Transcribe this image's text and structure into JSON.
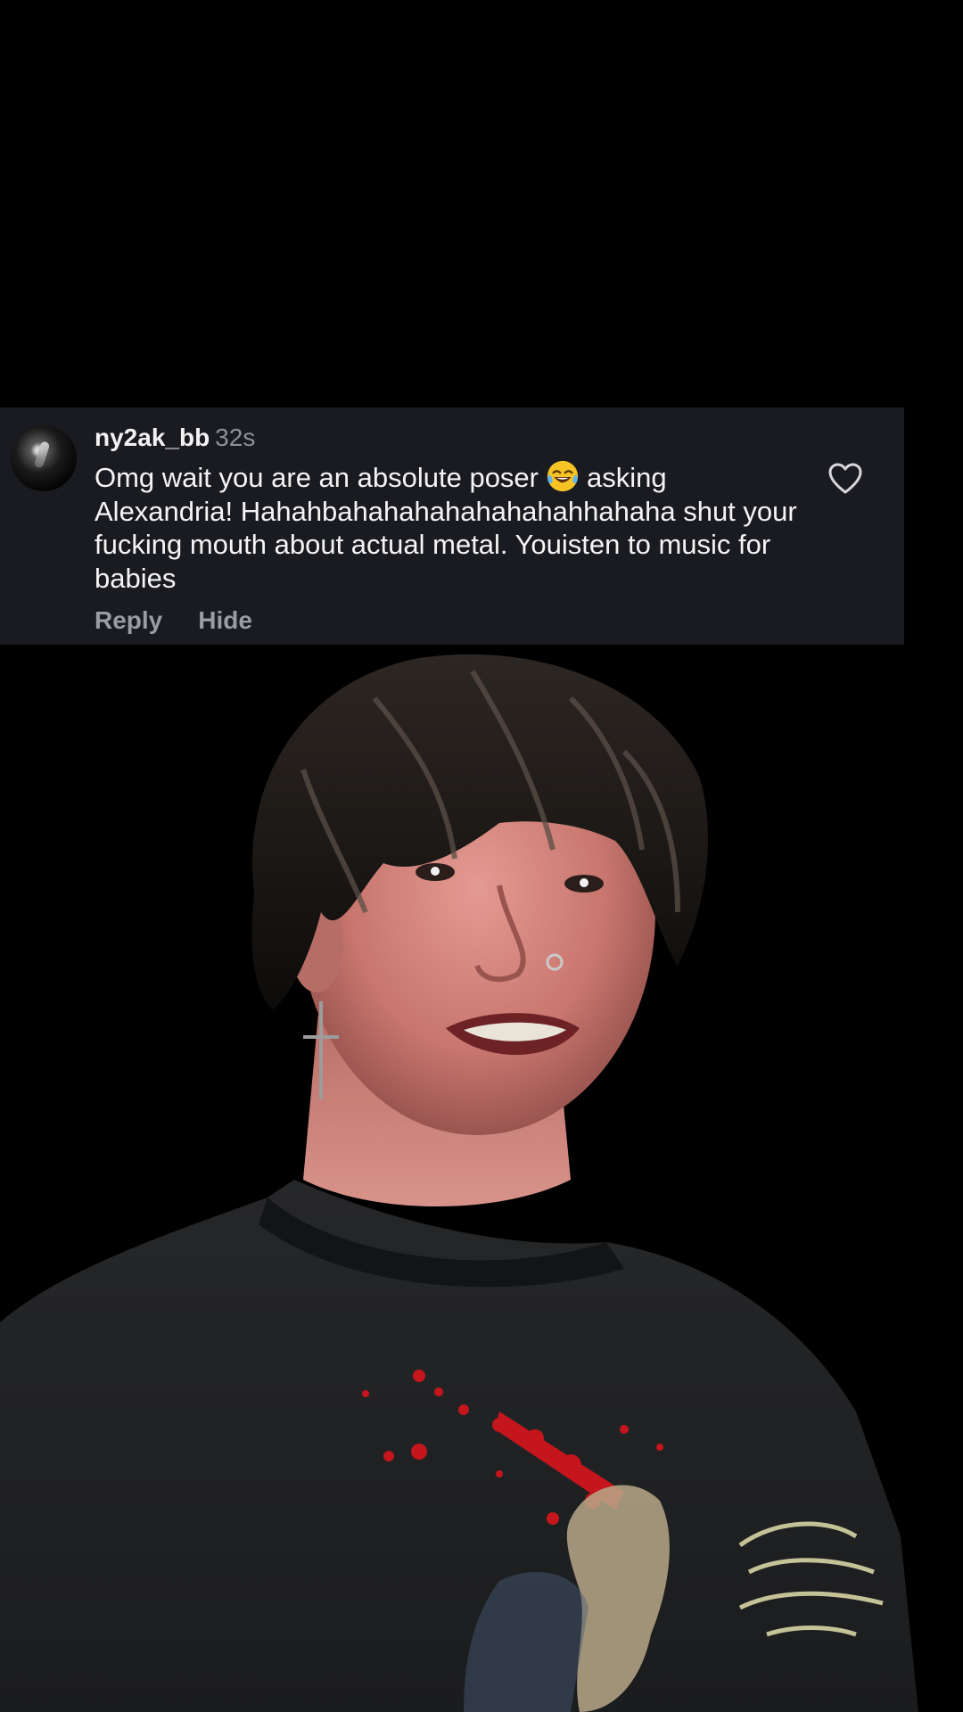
{
  "comment": {
    "username": "ny2ak_bb",
    "age": "32s",
    "text_line1_before_emoji": "Omg wait you are an absolute poser",
    "emoji": "face-with-tears-of-joy-icon",
    "text_line1_after_emoji": "asking",
    "text_rest": "Alexandria! Hahahbahahahahahahahahhahaha shut your fucking mouth about actual metal. Youisten to music for babies",
    "actions": {
      "reply_label": "Reply",
      "hide_label": "Hide"
    },
    "like_icon": "heart-outline-icon"
  },
  "colors": {
    "background": "#000000",
    "card_background": "#1a1b20",
    "username": "#f2f2f2",
    "timestamp": "#8e8f97",
    "body_text": "#f4f4f4",
    "action_text": "#9a9ba3",
    "shirt_splatter": "#c4161c"
  },
  "video": {
    "subject": "person-cutout"
  }
}
